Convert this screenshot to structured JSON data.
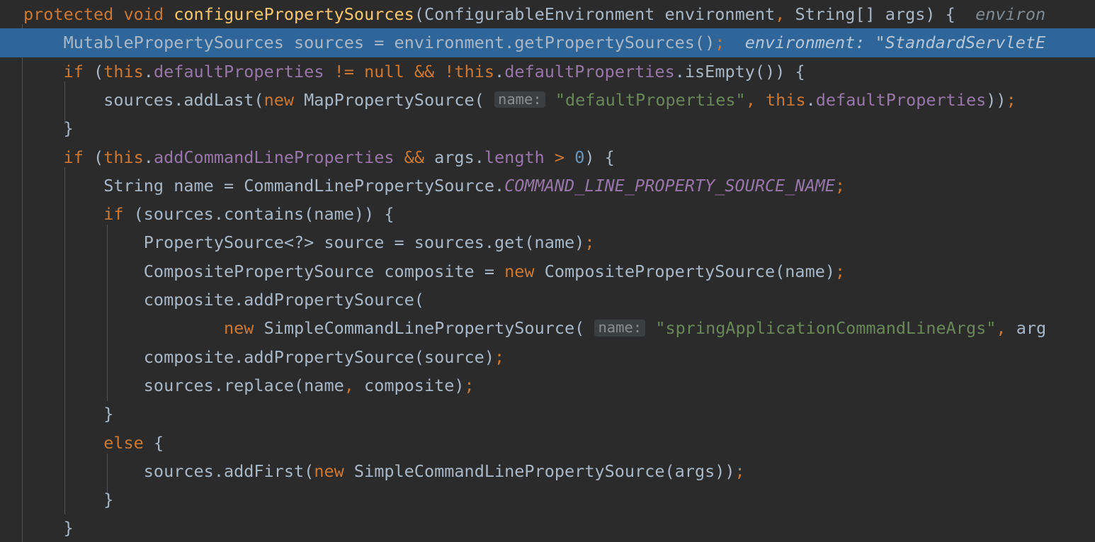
{
  "editor": {
    "name": "code-editor",
    "language": "java",
    "theme": "darcula",
    "background_color": "#2b2b2b",
    "default_text_color": "#a9b7c6",
    "current_line_highlight_color": "#2f6699",
    "indent_guide_color": "#4f5356",
    "colors": {
      "keyword": "#cc7832",
      "method_declaration": "#ffc66d",
      "field": "#9876aa",
      "static_final_field": "#9876aa",
      "string": "#6a8759",
      "number": "#6897bb",
      "identifier": "#a9b7c6",
      "semicolon": "#cc7832",
      "inline_hint": "#808b93",
      "param_hint_badge_bg": "#3c3f41",
      "param_hint_badge_fg": "#8c8c8c"
    },
    "param_hint_label": "name:",
    "lines": [
      {
        "index": 0,
        "highlighted": false,
        "indent": 0,
        "text": "protected void configurePropertySources(ConfigurableEnvironment environment, String[] args) {",
        "inline_hint": "environ",
        "inline_hint_clipped": true
      },
      {
        "index": 1,
        "highlighted": true,
        "indent": 1,
        "text": "MutablePropertySources sources = environment.getPropertySources();",
        "inline_hint": "environment: \"StandardServletE",
        "inline_hint_clipped": true
      },
      {
        "index": 2,
        "highlighted": false,
        "indent": 1,
        "text": "if (this.defaultProperties != null && !this.defaultProperties.isEmpty()) {"
      },
      {
        "index": 3,
        "highlighted": false,
        "indent": 2,
        "text": "sources.addLast(new MapPropertySource( name: \"defaultProperties\", this.defaultProperties));",
        "param_hint": "name:"
      },
      {
        "index": 4,
        "highlighted": false,
        "indent": 1,
        "text": "}"
      },
      {
        "index": 5,
        "highlighted": false,
        "indent": 1,
        "text": "if (this.addCommandLineProperties && args.length > 0) {"
      },
      {
        "index": 6,
        "highlighted": false,
        "indent": 2,
        "text": "String name = CommandLinePropertySource.COMMAND_LINE_PROPERTY_SOURCE_NAME;"
      },
      {
        "index": 7,
        "highlighted": false,
        "indent": 2,
        "text": "if (sources.contains(name)) {"
      },
      {
        "index": 8,
        "highlighted": false,
        "indent": 3,
        "text": "PropertySource<?> source = sources.get(name);"
      },
      {
        "index": 9,
        "highlighted": false,
        "indent": 3,
        "text": "CompositePropertySource composite = new CompositePropertySource(name);"
      },
      {
        "index": 10,
        "highlighted": false,
        "indent": 3,
        "text": "composite.addPropertySource("
      },
      {
        "index": 11,
        "highlighted": false,
        "indent": 5,
        "text": "new SimpleCommandLinePropertySource( name: \"springApplicationCommandLineArgs\", arg",
        "param_hint": "name:",
        "clipped": true
      },
      {
        "index": 12,
        "highlighted": false,
        "indent": 3,
        "text": "composite.addPropertySource(source);"
      },
      {
        "index": 13,
        "highlighted": false,
        "indent": 3,
        "text": "sources.replace(name, composite);"
      },
      {
        "index": 14,
        "highlighted": false,
        "indent": 2,
        "text": "}"
      },
      {
        "index": 15,
        "highlighted": false,
        "indent": 2,
        "text": "else {"
      },
      {
        "index": 16,
        "highlighted": false,
        "indent": 3,
        "text": "sources.addFirst(new SimpleCommandLinePropertySource(args));"
      },
      {
        "index": 17,
        "highlighted": false,
        "indent": 2,
        "text": "}"
      },
      {
        "index": 18,
        "highlighted": false,
        "indent": 1,
        "text": "}"
      }
    ]
  }
}
